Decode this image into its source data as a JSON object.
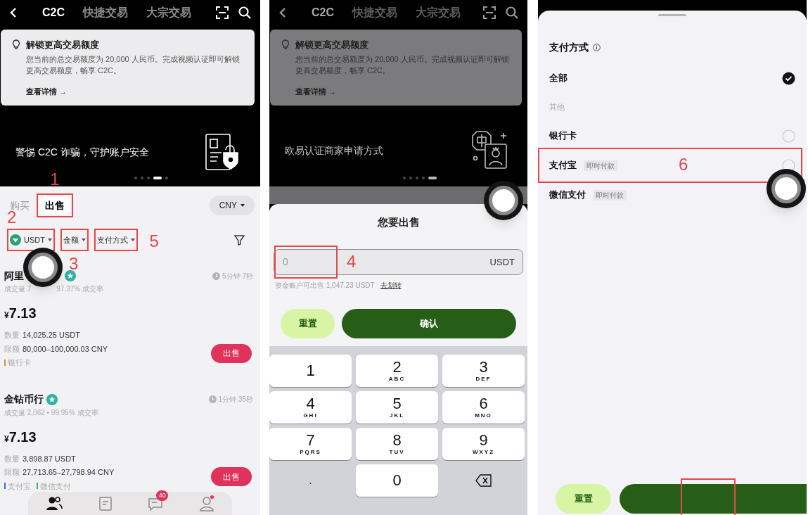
{
  "left_screen": {
    "dimmed": false,
    "assistive_button": true,
    "header": {
      "tabs": [
        {
          "label": "C2C",
          "selected": true
        },
        {
          "label": "快捷交易",
          "selected": false
        },
        {
          "label": "大宗交易",
          "selected": false
        }
      ]
    },
    "notice": {
      "title": "解锁更高交易额度",
      "body": "您当前的总交易额度为 20,000 人民币。完成视频认证即可解锁更高交易额度，畅享 C2C。",
      "link": "查看详情 →"
    },
    "banner": {
      "text": "警惕 C2C 诈骗，守护账户安全",
      "kind": "shield",
      "pages": [
        {
          "selected": false
        },
        {
          "selected": false
        },
        {
          "selected": false
        },
        {
          "selected": true
        },
        {
          "selected": false
        }
      ]
    },
    "side_tabs": [
      {
        "label": "购买",
        "selected": false
      },
      {
        "label": "出售",
        "selected": true,
        "annotation": "1"
      }
    ],
    "currency": "CNY",
    "filters": [
      {
        "label": "USDT",
        "kind": "coin",
        "annotation": "2"
      },
      {
        "label": "金额",
        "kind": "plain",
        "annotation": "3"
      },
      {
        "label": "支付方式",
        "kind": "plain",
        "annotation": "5"
      }
    ],
    "listings": [
      {
        "name": "阿里",
        "stats": [
          "成交量 7",
          "97.37% 成交率"
        ],
        "time": "5分钟 7秒",
        "currency_symbol": "¥",
        "price": "7.13",
        "quantity_label": "数量",
        "quantity": "14,025.25 USDT",
        "limit_label": "限额",
        "limit": "80,000–100,000.03 CNY",
        "payments": [
          {
            "label": "银行卡",
            "color": "#e8863a"
          }
        ],
        "action": "出售"
      },
      {
        "name": "金钻币行",
        "stats": [
          "成交量 2,062 • 99.95% 成交率"
        ],
        "time": "1分钟 35秒",
        "currency_symbol": "¥",
        "price": "7.13",
        "quantity_label": "数量",
        "quantity": "3,898.87 USDT",
        "limit_label": "限额",
        "limit": "27,713.65–27,798.94 CNY",
        "payments": [
          {
            "label": "支付宝",
            "color": "#2f6fd6"
          },
          {
            "label": "微信支付",
            "color": "#3fb36b"
          }
        ],
        "action": "出售"
      }
    ],
    "bottom_nav": [
      {
        "selected": true
      },
      {
        "selected": false
      },
      {
        "selected": false,
        "badge": "40"
      },
      {
        "selected": false,
        "dot": true
      }
    ]
  },
  "middle_screen": {
    "dimmed": true,
    "assistive_button": true,
    "header": {
      "tabs": [
        {
          "label": "C2C",
          "selected": true
        },
        {
          "label": "快捷交易",
          "selected": false
        },
        {
          "label": "大宗交易",
          "selected": false
        }
      ]
    },
    "notice": {
      "title": "解锁更高交易额度",
      "body": "您当前的总交易额度为 20,000 人民币。完成视频认证即可解锁更高交易额度，畅享 C2C。",
      "link": "查看详情 →"
    },
    "banner": {
      "text": "欧易认证商家申请方式",
      "kind": "merchant",
      "pages": [
        {
          "selected": false
        },
        {
          "selected": false
        },
        {
          "selected": false
        },
        {
          "selected": false
        },
        {
          "selected": true
        }
      ]
    },
    "sheet": {
      "title": "您要出售",
      "amount": {
        "placeholder": "0",
        "unit": "USDT",
        "annotation": "4"
      },
      "available": "资金账户可出售 1,047.23 USDT",
      "transfer_link": "去划转",
      "reset": "重置",
      "confirm": "确认"
    },
    "keypad": [
      {
        "kind": "key",
        "digit": "1"
      },
      {
        "kind": "key",
        "digit": "2",
        "letters": "ABC"
      },
      {
        "kind": "key",
        "digit": "3",
        "letters": "DEF"
      },
      {
        "kind": "key",
        "digit": "4",
        "letters": "GHI"
      },
      {
        "kind": "key",
        "digit": "5",
        "letters": "JKL"
      },
      {
        "kind": "key",
        "digit": "6",
        "letters": "MNO"
      },
      {
        "kind": "key",
        "digit": "7",
        "letters": "PQRS"
      },
      {
        "kind": "key",
        "digit": "8",
        "letters": "TUV"
      },
      {
        "kind": "key",
        "digit": "9",
        "letters": "WXYZ"
      },
      {
        "kind": "plain",
        "digit": "."
      },
      {
        "kind": "key",
        "digit": "0"
      },
      {
        "kind": "backspace"
      }
    ]
  },
  "right_screen": {
    "assistive_button": true,
    "sheet": {
      "title": "支付方式",
      "options": [
        {
          "kind": "option",
          "label": "全部",
          "checked": true
        },
        {
          "kind": "section",
          "label": "其他"
        },
        {
          "kind": "option",
          "label": "银行卡",
          "checked": false
        },
        {
          "kind": "option",
          "label": "支付宝",
          "tag": "即时付款",
          "checked": false,
          "annotation": "6"
        },
        {
          "kind": "option",
          "label": "微信支付",
          "tag": "即时付款"
        }
      ],
      "reset": "重置",
      "confirm_highlighted": true
    }
  }
}
